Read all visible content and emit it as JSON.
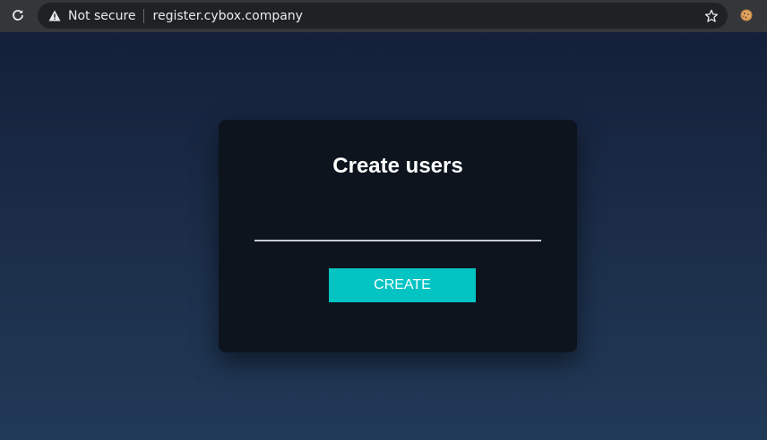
{
  "browser": {
    "security_label": "Not secure",
    "url": "register.cybox.company",
    "icons": {
      "reload": "reload-icon",
      "warning": "warning-icon",
      "star": "star-icon",
      "extension": "cookie-extension-icon"
    }
  },
  "form": {
    "title": "Create users",
    "username_value": "",
    "username_placeholder": "",
    "create_label": "CREATE"
  },
  "colors": {
    "accent": "#03c3c3",
    "card": "#0d141e",
    "page_top": "#14203a",
    "page_bottom": "#213a58",
    "chrome": "#35363a",
    "omnibox": "#202124"
  }
}
